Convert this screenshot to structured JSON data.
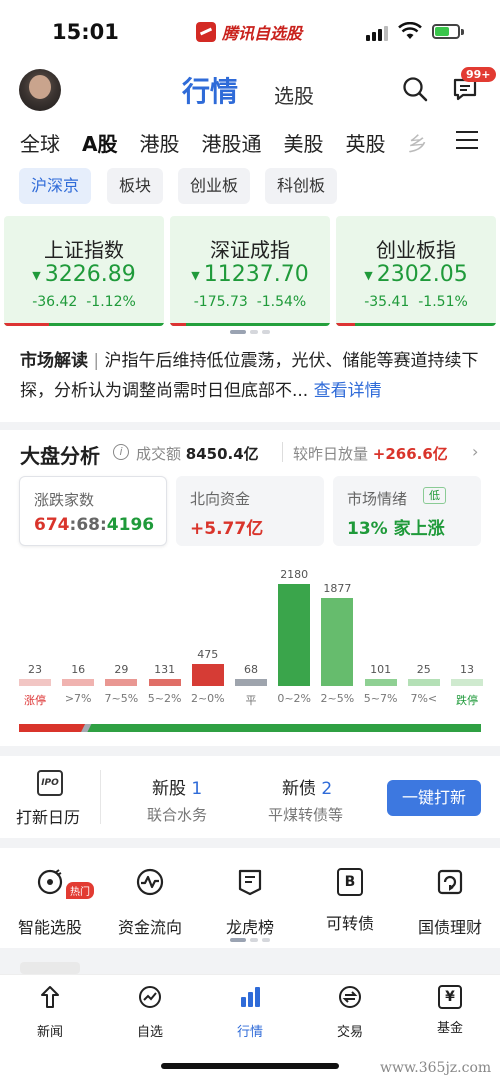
{
  "status": {
    "time": "15:01",
    "brand": "腾讯自选股"
  },
  "header": {
    "title": "行情",
    "second_tab": "选股",
    "badge": "99+",
    "market_tabs": [
      "全球",
      "A股",
      "港股",
      "港股通",
      "美股",
      "英股",
      "乡"
    ]
  },
  "subtabs": [
    "沪深京",
    "板块",
    "创业板",
    "科创板"
  ],
  "indices": [
    {
      "name": "上证指数",
      "price": "3226.89",
      "chg": "-36.42",
      "pct": "-1.12%",
      "up_ratio": 0.28
    },
    {
      "name": "深证成指",
      "price": "11237.70",
      "chg": "-175.73",
      "pct": "-1.54%",
      "up_ratio": 0.1
    },
    {
      "name": "创业板指",
      "price": "2302.05",
      "chg": "-35.41",
      "pct": "-1.51%",
      "up_ratio": 0.12
    }
  ],
  "interpretation": {
    "label": "市场解读",
    "sep": "|",
    "text": "沪指午后维持低位震荡，光伏、储能等赛道持续下探，分析认为调整尚需时日但底部不...",
    "more": "查看详情"
  },
  "analysis": {
    "title": "大盘分析",
    "info_icon": "i",
    "volume_label": "成交额",
    "volume_value": "8450.4亿",
    "compare_label": "较昨日放量",
    "compare_value": "+266.6亿",
    "stats": [
      {
        "label": "涨跌家数",
        "up": "674",
        "sep1": ":",
        "flat": "68",
        "sep2": ":",
        "down": "4196"
      },
      {
        "label": "北向资金",
        "value": "+5.77亿"
      },
      {
        "label": "市场情绪",
        "tag": "低",
        "value": "13% 家上涨"
      }
    ]
  },
  "chart_data": {
    "type": "bar",
    "categories": [
      "涨停",
      ">7%",
      "7~5%",
      "5~2%",
      "2~0%",
      "平",
      "0~2%",
      "2~5%",
      "5~7%",
      "7%<",
      "跌停"
    ],
    "values": [
      23,
      16,
      29,
      131,
      475,
      68,
      2180,
      1877,
      101,
      25,
      13
    ],
    "colors": [
      "#f2c6c4",
      "#f0b3b0",
      "#e99792",
      "#e06e67",
      "#d63c35",
      "#9ea4ad",
      "#3aa54b",
      "#66bc6d",
      "#8fd093",
      "#b4e0b6",
      "#cfeacf"
    ],
    "label_colors": [
      "#d33",
      "#777",
      "#777",
      "#777",
      "#777",
      "#777",
      "#777",
      "#777",
      "#777",
      "#777",
      "#1f9a3a"
    ],
    "ratio": {
      "up": 674,
      "flat": 68,
      "down": 4196
    }
  },
  "ipo": {
    "calendar_label": "打新日历",
    "calendar_icon_text": "IPO",
    "new_stock": {
      "title": "新股",
      "count": "1",
      "sub": "联合水务"
    },
    "new_bond": {
      "title": "新债",
      "count": "2",
      "sub": "平煤转债等"
    },
    "button": "一键打新"
  },
  "tools": [
    {
      "label": "智能选股",
      "icon": "smart-pick-icon",
      "hot": "热门"
    },
    {
      "label": "资金流向",
      "icon": "fund-flow-icon"
    },
    {
      "label": "龙虎榜",
      "icon": "dragon-tiger-icon"
    },
    {
      "label": "可转债",
      "icon": "convertible-bond-icon",
      "glyph": "B"
    },
    {
      "label": "国债理财",
      "icon": "treasury-icon"
    }
  ],
  "tabbar": [
    {
      "label": "新闻",
      "icon": "news-icon"
    },
    {
      "label": "自选",
      "icon": "watchlist-icon"
    },
    {
      "label": "行情",
      "icon": "market-icon",
      "active": true
    },
    {
      "label": "交易",
      "icon": "trade-icon"
    },
    {
      "label": "基金",
      "icon": "fund-icon",
      "glyph": "¥"
    }
  ],
  "watermark": "www.365jz.com"
}
